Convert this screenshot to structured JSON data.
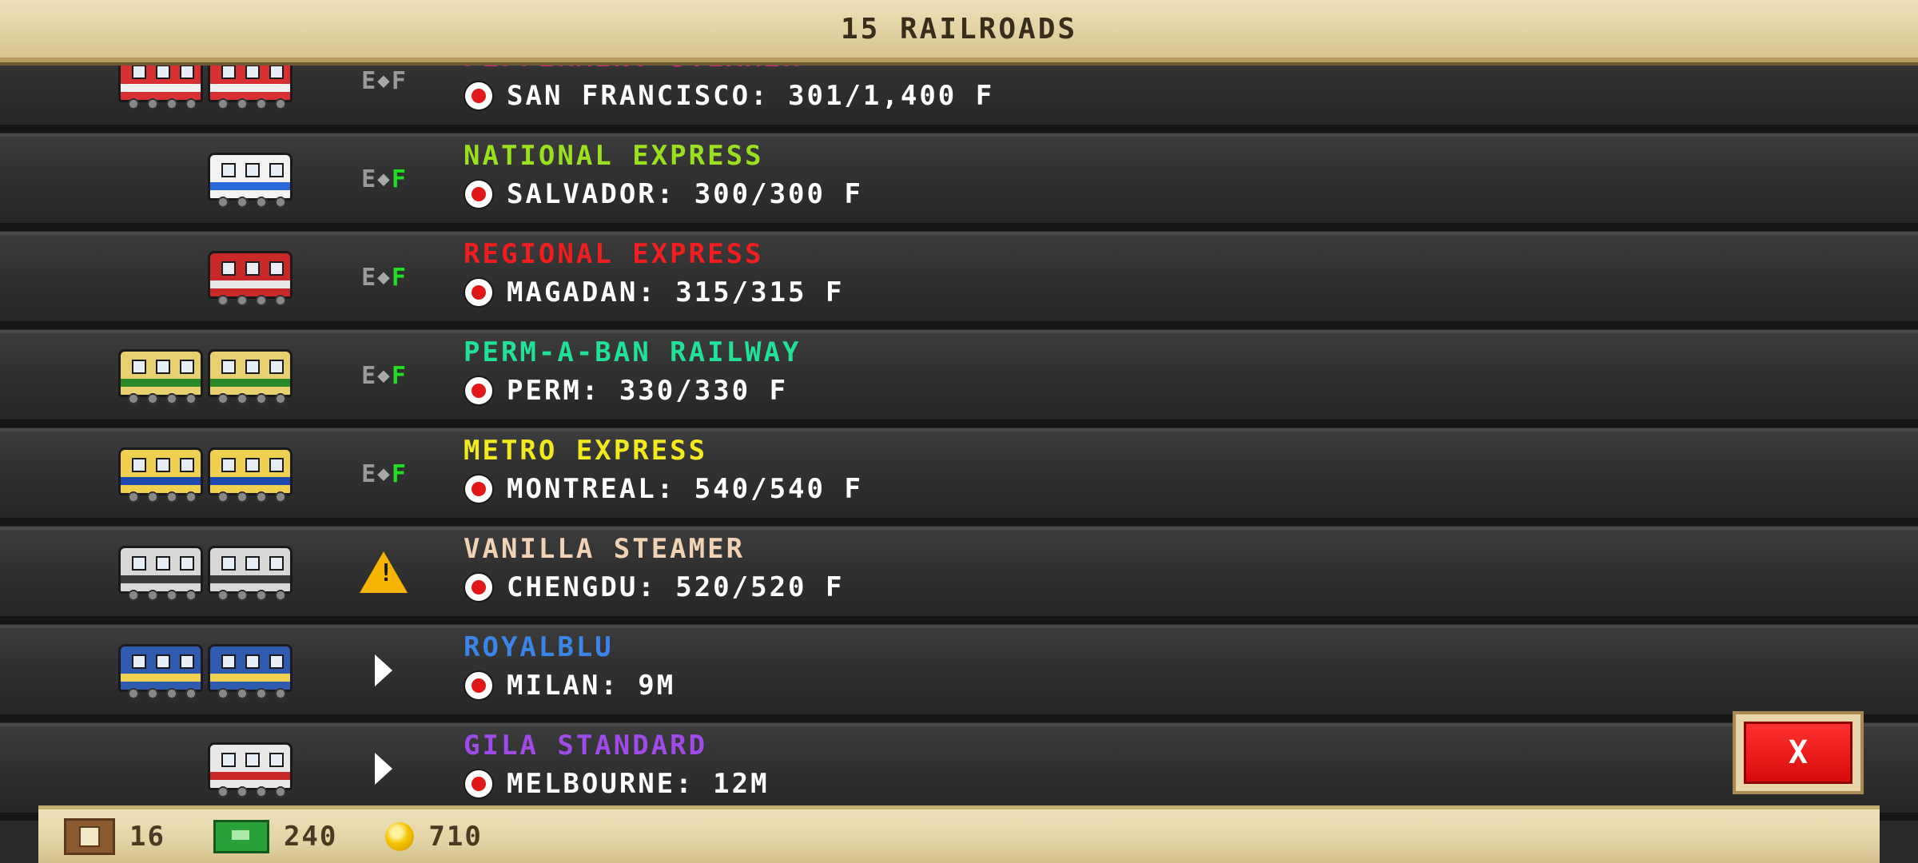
{
  "header": {
    "title": "15 RAILROADS"
  },
  "railroads": [
    {
      "name": "PEPPERMINT STEAMER",
      "name_color": "#e8208a",
      "destination": "SAN FRANCISCO: 301/1,400 F",
      "status": "fuel",
      "fuel_full": false,
      "train": [
        "#d83030",
        "#d83030"
      ],
      "train_accent": "#f2f2f2"
    },
    {
      "name": "NATIONAL EXPRESS",
      "name_color": "#9be01e",
      "destination": "SALVADOR: 300/300 F",
      "status": "fuel",
      "fuel_full": true,
      "train": [
        "#f2f2f2"
      ],
      "train_accent": "#2a6ad8"
    },
    {
      "name": "REGIONAL EXPRESS",
      "name_color": "#f01e1e",
      "destination": "MAGADAN: 315/315 F",
      "status": "fuel",
      "fuel_full": true,
      "train": [
        "#c82828"
      ],
      "train_accent": "#e8e8e8"
    },
    {
      "name": "PERM-A-BAN RAILWAY",
      "name_color": "#22e098",
      "destination": "PERM: 330/330 F",
      "status": "fuel",
      "fuel_full": true,
      "train": [
        "#e8d070",
        "#e8d070"
      ],
      "train_accent": "#2a8a2a"
    },
    {
      "name": "METRO EXPRESS",
      "name_color": "#f2ea1e",
      "destination": "MONTREAL: 540/540 F",
      "status": "fuel",
      "fuel_full": true,
      "train": [
        "#f0d050",
        "#f0d050"
      ],
      "train_accent": "#1e4ab0"
    },
    {
      "name": "VANILLA STEAMER",
      "name_color": "#f2d2b4",
      "destination": "CHENGDU: 520/520 F",
      "status": "warning",
      "fuel_full": true,
      "train": [
        "#d8d8d8",
        "#d8d8d8"
      ],
      "train_accent": "#3a3a3a"
    },
    {
      "name": "ROYALBLU",
      "name_color": "#3a86e8",
      "destination": "MILAN: 9M",
      "status": "moving",
      "fuel_full": true,
      "train": [
        "#2e5ab0",
        "#2e5ab0"
      ],
      "train_accent": "#f0d050"
    },
    {
      "name": "GILA STANDARD",
      "name_color": "#a04ae8",
      "destination": "MELBOURNE: 12M",
      "status": "moving",
      "fuel_full": true,
      "train": [
        "#e8e8e8"
      ],
      "train_accent": "#c82828"
    }
  ],
  "status_labels": {
    "empty": "E",
    "full": "F",
    "warning": "!"
  },
  "footer": {
    "crates": "16",
    "cash": "240",
    "coins": "710"
  },
  "close_button": {
    "label": "X"
  },
  "icons": {
    "crate": "crate-icon",
    "cash": "cash-icon",
    "coin": "coin-icon",
    "pin": "location-pin-icon",
    "warning": "warning-icon",
    "play": "play-icon"
  }
}
